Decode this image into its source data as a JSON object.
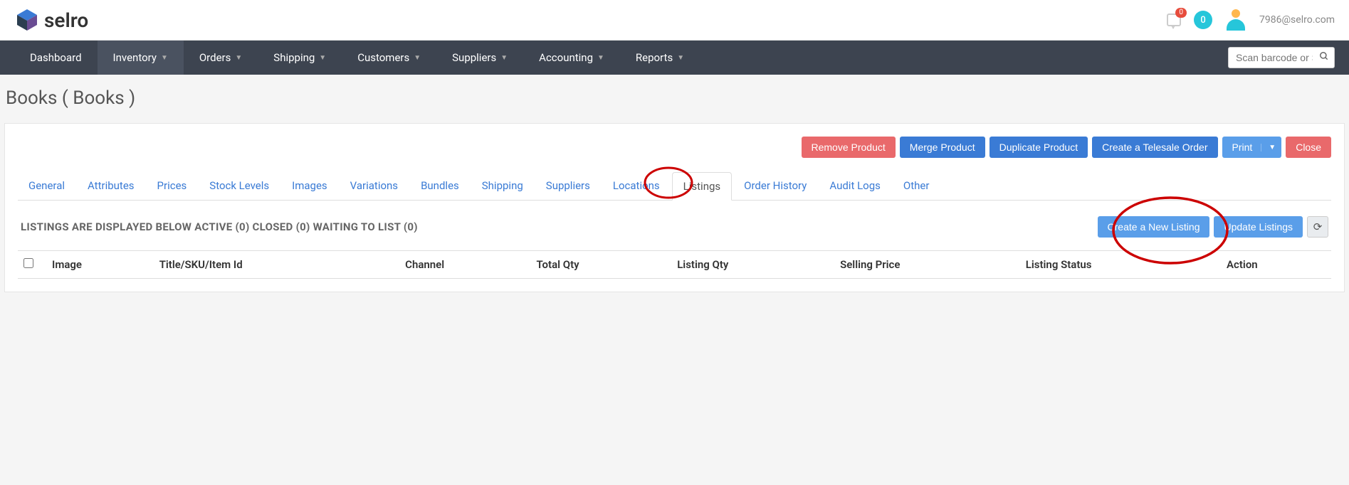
{
  "logo": {
    "text": "selro"
  },
  "header": {
    "notif_count": "0",
    "circle_count": "0",
    "user_email": "7986@selro.com"
  },
  "nav": {
    "items": [
      {
        "label": "Dashboard",
        "dropdown": false,
        "active": false
      },
      {
        "label": "Inventory",
        "dropdown": true,
        "active": true
      },
      {
        "label": "Orders",
        "dropdown": true,
        "active": false
      },
      {
        "label": "Shipping",
        "dropdown": true,
        "active": false
      },
      {
        "label": "Customers",
        "dropdown": true,
        "active": false
      },
      {
        "label": "Suppliers",
        "dropdown": true,
        "active": false
      },
      {
        "label": "Accounting",
        "dropdown": true,
        "active": false
      },
      {
        "label": "Reports",
        "dropdown": true,
        "active": false
      }
    ],
    "search_placeholder": "Scan barcode or Search"
  },
  "page_title": "Books ( Books )",
  "actions": {
    "remove": "Remove Product",
    "merge": "Merge Product",
    "duplicate": "Duplicate Product",
    "telesale": "Create a Telesale Order",
    "print": "Print",
    "close": "Close"
  },
  "tabs": [
    {
      "label": "General",
      "active": false
    },
    {
      "label": "Attributes",
      "active": false
    },
    {
      "label": "Prices",
      "active": false
    },
    {
      "label": "Stock Levels",
      "active": false
    },
    {
      "label": "Images",
      "active": false
    },
    {
      "label": "Variations",
      "active": false
    },
    {
      "label": "Bundles",
      "active": false
    },
    {
      "label": "Shipping",
      "active": false
    },
    {
      "label": "Suppliers",
      "active": false
    },
    {
      "label": "Locations",
      "active": false
    },
    {
      "label": "Listings",
      "active": true
    },
    {
      "label": "Order History",
      "active": false
    },
    {
      "label": "Audit Logs",
      "active": false
    },
    {
      "label": "Other",
      "active": false
    }
  ],
  "listings": {
    "title": "LISTINGS ARE DISPLAYED BELOW ACTIVE (0) CLOSED (0) WAITING TO LIST (0)",
    "create_label": "Create a New Listing",
    "update_label": "Update Listings"
  },
  "table": {
    "columns": [
      "Image",
      "Title/SKU/Item Id",
      "Channel",
      "Total Qty",
      "Listing Qty",
      "Selling Price",
      "Listing Status",
      "Action"
    ]
  }
}
